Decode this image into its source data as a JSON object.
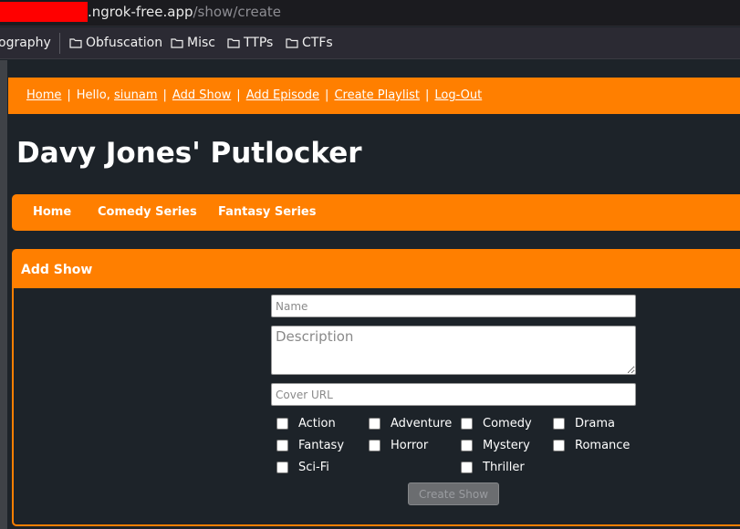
{
  "browser": {
    "url_host": ".ngrok-free.app",
    "url_path": "/show/create",
    "bookmarks": [
      {
        "label": "ography",
        "icon": "none"
      },
      {
        "label": "Obfuscation",
        "icon": "folder-icon"
      },
      {
        "label": "Misc",
        "icon": "folder-icon"
      },
      {
        "label": "TTPs",
        "icon": "folder-icon"
      },
      {
        "label": "CTFs",
        "icon": "folder-icon"
      }
    ]
  },
  "topnav": {
    "home": "Home",
    "hello": "Hello,",
    "user": "siunam",
    "add_show": "Add Show",
    "add_episode": "Add Episode",
    "create_playlist": "Create Playlist",
    "logout": "Log-Out",
    "separator": "|"
  },
  "site_title": "Davy Jones' Putlocker",
  "catnav": {
    "items": [
      "Home",
      "Comedy Series",
      "Fantasy Series"
    ]
  },
  "form": {
    "heading": "Add Show",
    "name_placeholder": "Name",
    "description_placeholder": "Description",
    "cover_placeholder": "Cover URL",
    "genres": [
      "Action",
      "Adventure",
      "Comedy",
      "Drama",
      "Fantasy",
      "Horror",
      "Mystery",
      "Romance",
      "Sci-Fi",
      "Thriller"
    ],
    "submit_label": "Create Show"
  },
  "colors": {
    "accent": "#ff7f00",
    "background": "#1d2329",
    "redaction": "#ff0000"
  }
}
